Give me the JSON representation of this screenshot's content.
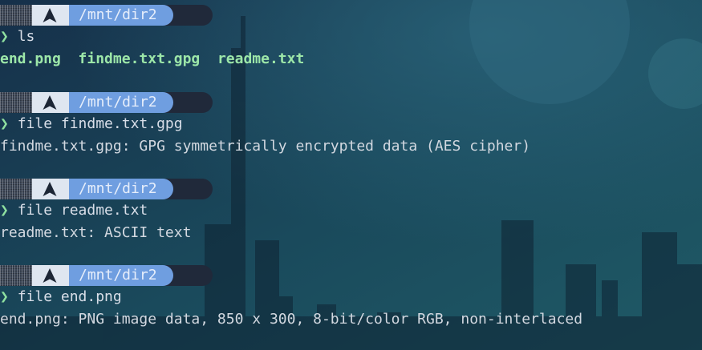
{
  "prompt": {
    "os_icon": "arch-linux-icon",
    "path": "/mnt/dir2",
    "symbol": "❯"
  },
  "colors": {
    "path_segment": "#6f9ee0",
    "os_segment": "#dfe6f0",
    "prompt_symbol": "#8fe0a0",
    "ls_entries": "#9ce6a8",
    "text": "#d2d8e0"
  },
  "blocks": [
    {
      "command": "ls",
      "output_items": [
        "end.png",
        "findme.txt.gpg",
        "readme.txt"
      ]
    },
    {
      "command": "file findme.txt.gpg",
      "output": "findme.txt.gpg: GPG symmetrically encrypted data (AES cipher)"
    },
    {
      "command": "file readme.txt",
      "output": "readme.txt: ASCII text"
    },
    {
      "command": "file end.png",
      "output": "end.png: PNG image data, 850 x 300, 8-bit/color RGB, non-interlaced"
    }
  ]
}
